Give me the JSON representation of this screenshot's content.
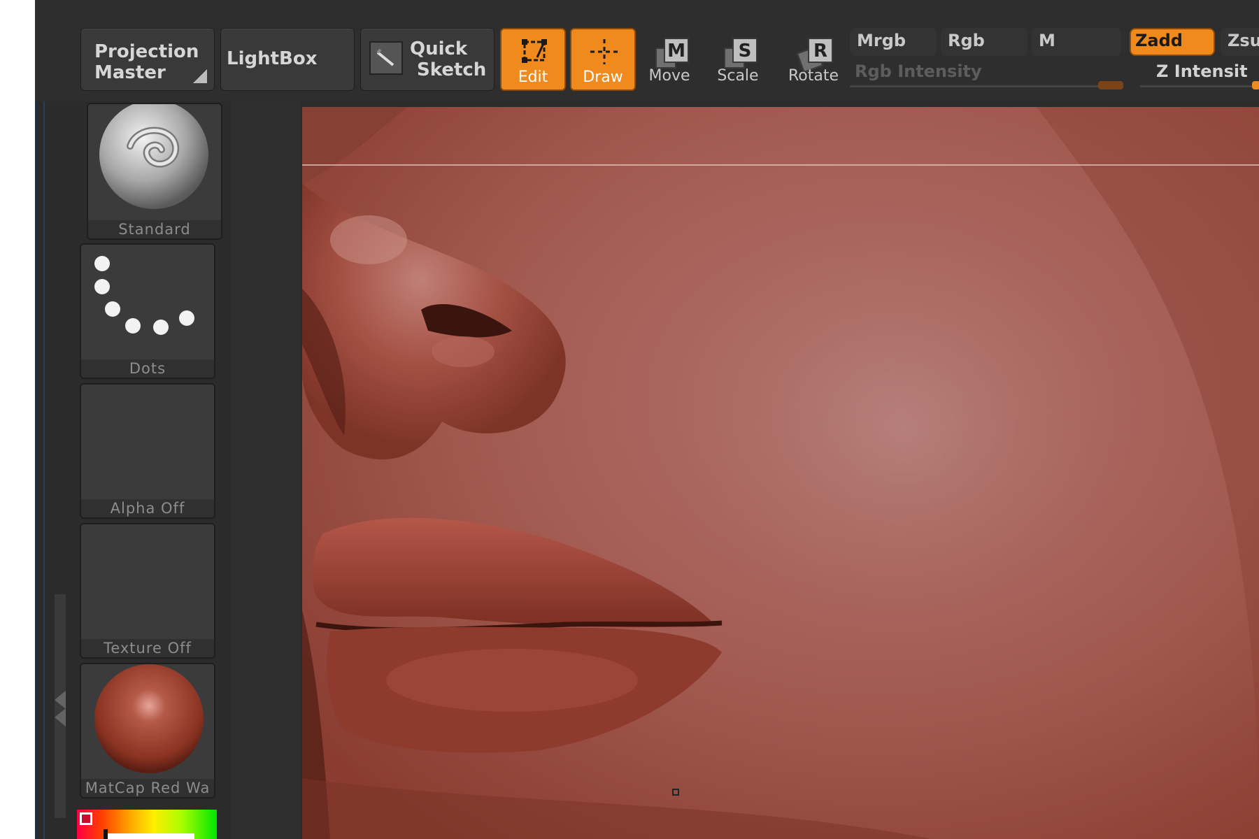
{
  "toolbar": {
    "projection_master": {
      "line1": "Projection",
      "line2": "Master"
    },
    "lightbox": "LightBox",
    "quick_sketch": {
      "line1": "Quick",
      "line2": "Sketch"
    },
    "tools": [
      {
        "label": "Edit",
        "icon": "edit-icon",
        "active": true
      },
      {
        "label": "Draw",
        "icon": "draw-icon",
        "active": true
      },
      {
        "label": "Move",
        "icon": "move-icon",
        "letter": "M",
        "active": false
      },
      {
        "label": "Scale",
        "icon": "scale-icon",
        "letter": "S",
        "active": false
      },
      {
        "label": "Rotate",
        "icon": "rotate-icon",
        "letter": "R",
        "active": false
      }
    ],
    "modes": {
      "mrgb": "Mrgb",
      "rgb": "Rgb",
      "m": "M",
      "zadd": "Zadd",
      "zsub": "Zsu"
    },
    "rgb_intensity_label": "Rgb  Intensity",
    "z_intensity_label": "Z  Intensit",
    "active_color": "#f08a1c"
  },
  "left_panel": {
    "brush": {
      "label": "Standard",
      "icon": "standard-brush-icon"
    },
    "stroke": {
      "label": "Dots",
      "icon": "dots-stroke-icon"
    },
    "alpha": {
      "label": "Alpha  Off"
    },
    "texture": {
      "label": "Texture  Off"
    },
    "material": {
      "label": "MatCap  Red  Wa",
      "icon": "matcap-sphere-icon"
    }
  },
  "viewport": {
    "surface_color": "#9e524a"
  }
}
